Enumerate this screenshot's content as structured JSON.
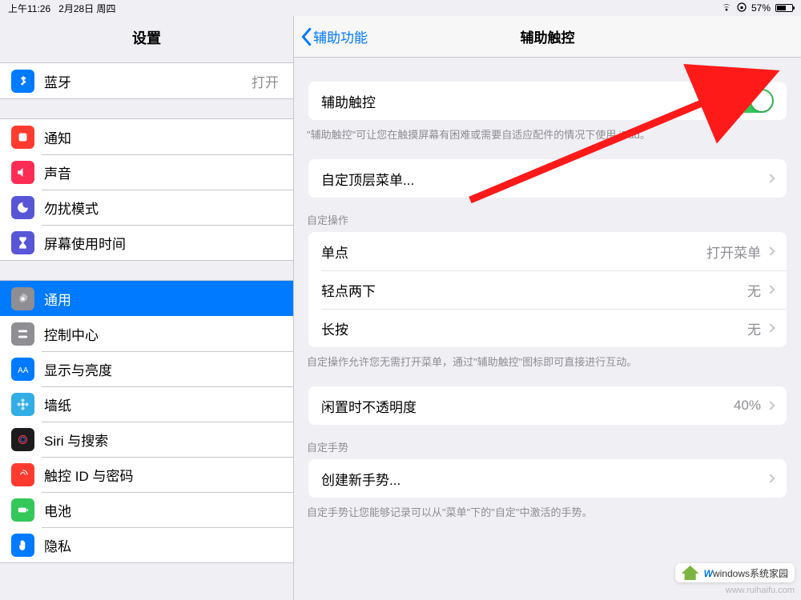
{
  "statusbar": {
    "time": "上午11:26",
    "date": "2月28日 周四",
    "battery": "57%"
  },
  "sidebar": {
    "title": "设置",
    "bluetooth": {
      "label": "蓝牙",
      "value": "打开"
    },
    "items": [
      {
        "label": "通知"
      },
      {
        "label": "声音"
      },
      {
        "label": "勿扰模式"
      },
      {
        "label": "屏幕使用时间"
      }
    ],
    "items2": [
      {
        "label": "通用"
      },
      {
        "label": "控制中心"
      },
      {
        "label": "显示与亮度"
      },
      {
        "label": "墙纸"
      },
      {
        "label": "Siri 与搜索"
      },
      {
        "label": "触控 ID 与密码"
      },
      {
        "label": "电池"
      },
      {
        "label": "隐私"
      }
    ]
  },
  "detail": {
    "back_label": "辅助功能",
    "title": "辅助触控",
    "toggle_label": "辅助触控",
    "toggle_footer": "\"辅助触控\"可让您在触摸屏幕有困难或需要自适应配件的情况下使用 iPad。",
    "customize_top": "自定顶层菜单...",
    "custom_actions_header": "自定操作",
    "tap": {
      "label": "单点",
      "value": "打开菜单"
    },
    "double": {
      "label": "轻点两下",
      "value": "无"
    },
    "long": {
      "label": "长按",
      "value": "无"
    },
    "actions_footer": "自定操作允许您无需打开菜单，通过\"辅助触控\"图标即可直接进行互动。",
    "idle": {
      "label": "闲置时不透明度",
      "value": "40%"
    },
    "gestures_header": "自定手势",
    "new_gesture": "创建新手势...",
    "gestures_footer": "自定手势让您能够记录可以从\"菜单\"下的\"自定\"中激活的手势。"
  },
  "branding": {
    "badge": "windows系统家园",
    "watermark": "www.ruihaifu.com",
    "w": "W"
  }
}
